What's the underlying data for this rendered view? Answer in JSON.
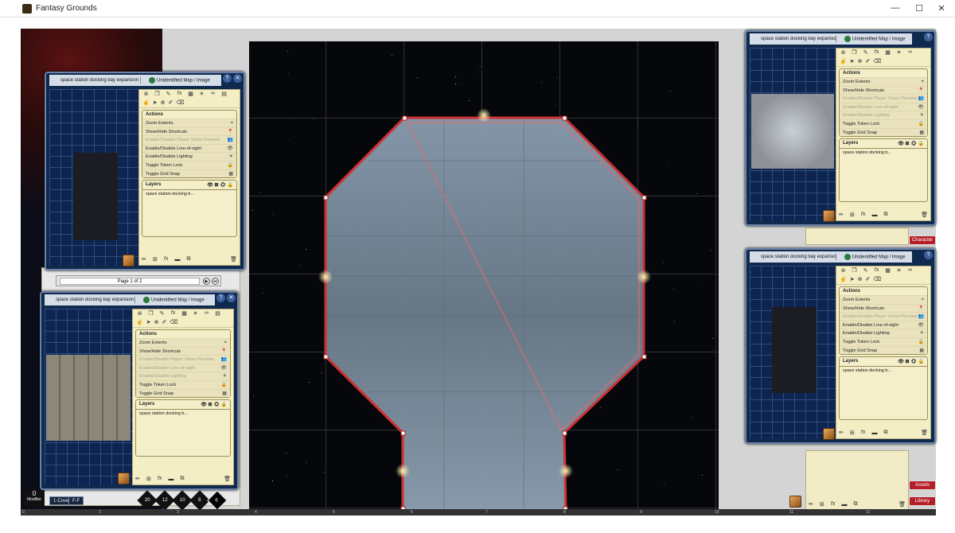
{
  "window": {
    "title": "Fantasy Grounds",
    "controls": [
      "—",
      "☐",
      "✕"
    ]
  },
  "panel": {
    "tab1": "space station docking bay expansion",
    "tab2": "Unidentified Map / Image",
    "actions_title": "Actions",
    "actions": [
      {
        "label": "Zoom Extents",
        "icon": "⌖",
        "enabled": true
      },
      {
        "label": "Show/Hide Shortcuts",
        "icon": "📍",
        "enabled": true
      },
      {
        "label": "Enable/Disable Player Vision Preview",
        "icon": "👥",
        "enabled": false
      },
      {
        "label": "Enable/Disable Line-of-sight",
        "icon": "👁",
        "enabled": true
      },
      {
        "label": "Enable/Disable Lighting",
        "icon": "☀",
        "enabled": true
      },
      {
        "label": "Toggle Token Lock",
        "icon": "🔒",
        "enabled": true
      },
      {
        "label": "Toggle Grid Snap",
        "icon": "▦",
        "enabled": true
      }
    ],
    "actions_dim_variant": [
      false,
      false,
      true,
      true,
      true,
      false,
      false
    ],
    "layers_title": "Layers",
    "layer_row": "space station docking b..."
  },
  "pagenav": {
    "text": "Page 1 of 2"
  },
  "bottom": {
    "modifier_value": "0",
    "modifier_label": "Modifier",
    "cover1": "1-Cover",
    "cover2": "F-F",
    "dice": [
      "20",
      "12",
      "10",
      "8",
      "6"
    ]
  },
  "sidebar_buttons": {
    "character": "Character",
    "assets": "Assets",
    "library": "Library"
  },
  "ruler": [
    "0",
    "2",
    "3",
    "4",
    "5",
    "6",
    "7",
    "8",
    "9",
    "10",
    "11",
    "12"
  ],
  "colors": {
    "panel_blue": "#0f2a4e",
    "parchment": "#f3eec4",
    "wall_red": "#d03030",
    "fg_red": "#b51e28"
  }
}
